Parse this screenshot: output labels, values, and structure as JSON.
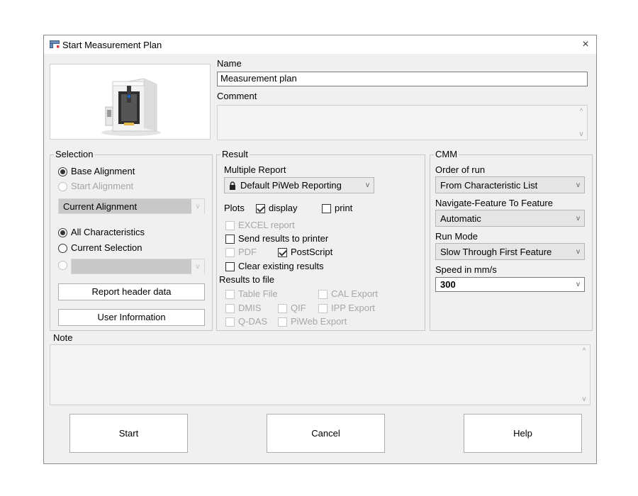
{
  "window": {
    "title": "Start Measurement Plan",
    "icon": "plan-window-icon",
    "close_glyph": "×"
  },
  "name_section": {
    "name_label": "Name",
    "name_value": "Measurement plan",
    "comment_label": "Comment",
    "comment_value": ""
  },
  "selection": {
    "title": "Selection",
    "base_alignment": "Base Alignment",
    "start_alignment": "Start Alignment",
    "alignment_combo": "Current Alignment",
    "all_characteristics": "All Characteristics",
    "current_selection": "Current Selection",
    "empty_combo": "",
    "report_header_button": "Report header data",
    "user_information_button": "User Information"
  },
  "result": {
    "title": "Result",
    "multiple_report_label": "Multiple Report",
    "multiple_report_value": "Default PiWeb Reporting",
    "plots_label": "Plots",
    "display_label": "display",
    "print_label": "print",
    "excel_report": "EXCEL report",
    "send_to_printer": "Send results to printer",
    "pdf": "PDF",
    "postscript": "PostScript",
    "clear_results": "Clear existing results",
    "results_to_file": "Results to file",
    "table_file": "Table File",
    "cal_export": "CAL Export",
    "dmis": "DMIS",
    "qif": "QIF",
    "ipp_export": "IPP Export",
    "qdas": "Q-DAS",
    "piweb_export": "PiWeb Export"
  },
  "cmm": {
    "title": "CMM",
    "order_label": "Order of run",
    "order_value": "From Characteristic List",
    "navigate_label": "Navigate-Feature To Feature",
    "navigate_value": "Automatic",
    "run_mode_label": "Run Mode",
    "run_mode_value": "Slow Through First Feature",
    "speed_label": "Speed in mm/s",
    "speed_value": "300"
  },
  "note": {
    "label": "Note",
    "value": ""
  },
  "buttons": {
    "start": "Start",
    "cancel": "Cancel",
    "help": "Help"
  }
}
